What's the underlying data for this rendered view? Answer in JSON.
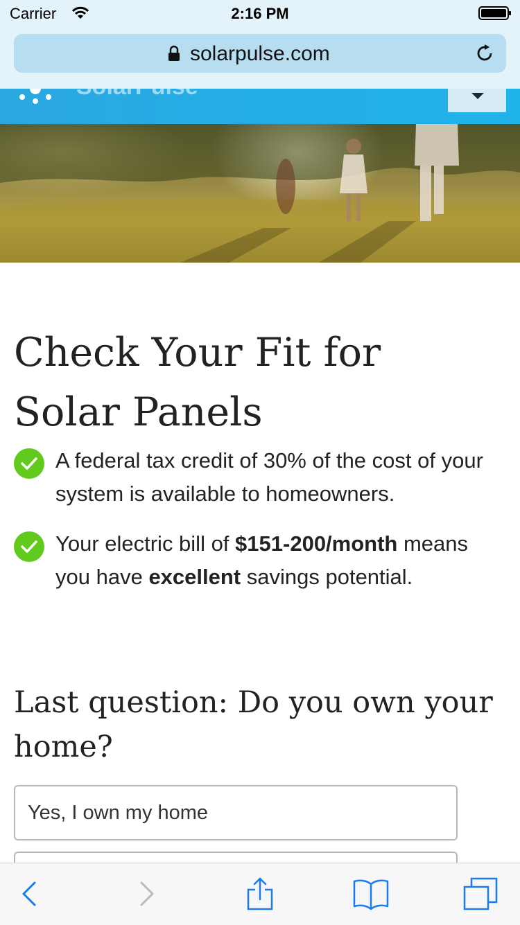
{
  "status_bar": {
    "carrier": "Carrier",
    "time": "2:16 PM"
  },
  "browser": {
    "url": "solarpulse.com",
    "icons": [
      "lock-icon",
      "reload-icon"
    ]
  },
  "site": {
    "brand_name": "SolarPulse",
    "icons": [
      "sun-logo-icon",
      "chevron-down-icon"
    ],
    "accent_color": "#1fb3ea"
  },
  "main": {
    "headline": "Check Your Fit for Solar Panels",
    "benefits": [
      {
        "text": "A federal tax credit of 30% of the cost of your system is available to homeowners."
      },
      {
        "prefix": "Your electric bill of ",
        "bill": "$151-200/month",
        "middle": " means you have ",
        "rating": "excellent",
        "suffix": " savings potential."
      }
    ],
    "check_color": "#62c91d",
    "question": "Last question: Do you own your home?",
    "answers": [
      {
        "label": "Yes, I own my home"
      },
      {
        "label": ""
      }
    ]
  },
  "toolbar": {
    "icons": [
      "back-icon",
      "forward-icon",
      "share-icon",
      "bookmarks-icon",
      "tabs-icon"
    ]
  }
}
